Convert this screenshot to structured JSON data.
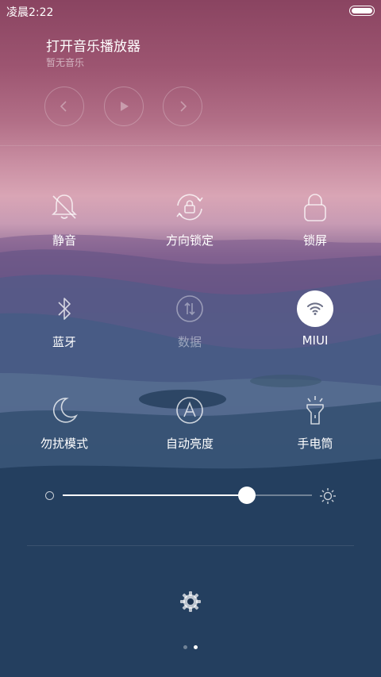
{
  "status_bar": {
    "time": "凌晨2:22"
  },
  "music": {
    "title": "打开音乐播放器",
    "subtitle": "暂无音乐",
    "controls": [
      "previous-icon",
      "play-icon",
      "next-icon"
    ]
  },
  "toggles": [
    {
      "label": "静音",
      "icon": "bell-off-icon",
      "active": false
    },
    {
      "label": "方向锁定",
      "icon": "rotation-lock-icon",
      "active": false
    },
    {
      "label": "锁屏",
      "icon": "lock-icon",
      "active": false
    },
    {
      "label": "蓝牙",
      "icon": "bluetooth-icon",
      "active": false
    },
    {
      "label": "数据",
      "icon": "mobile-data-icon",
      "active": false
    },
    {
      "label": "MIUI",
      "icon": "wifi-icon",
      "active": true
    },
    {
      "label": "勿扰模式",
      "icon": "moon-icon",
      "active": false
    },
    {
      "label": "自动亮度",
      "icon": "auto-brightness-icon",
      "active": false
    },
    {
      "label": "手电筒",
      "icon": "flashlight-icon",
      "active": false
    }
  ],
  "brightness": {
    "level": 0.74
  },
  "pager": {
    "pages": 2,
    "current": 2
  },
  "colors": {
    "accent": "#ffffff",
    "wifi_icon": "#6b6f86"
  }
}
